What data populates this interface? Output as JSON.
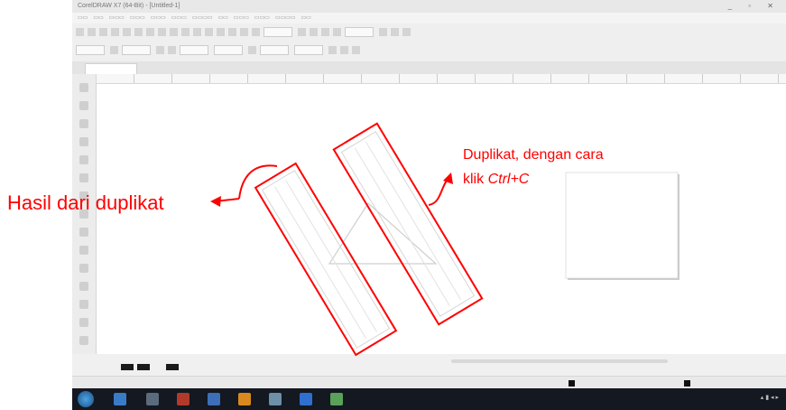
{
  "app": {
    "title_bar_text": "CorelDRAW X7 (64-Bit) - [Untitled-1]",
    "window_controls": "_ ▫ ✕"
  },
  "annotations": {
    "left_label": "Hasil dari duplikat",
    "right_label_line1": "Duplikat, dengan cara",
    "right_label_line2_prefix": "klik ",
    "right_label_line2_keys": "Ctrl+C"
  },
  "colors": {
    "annotation": "#ff0000",
    "taskbar": "#131821"
  }
}
